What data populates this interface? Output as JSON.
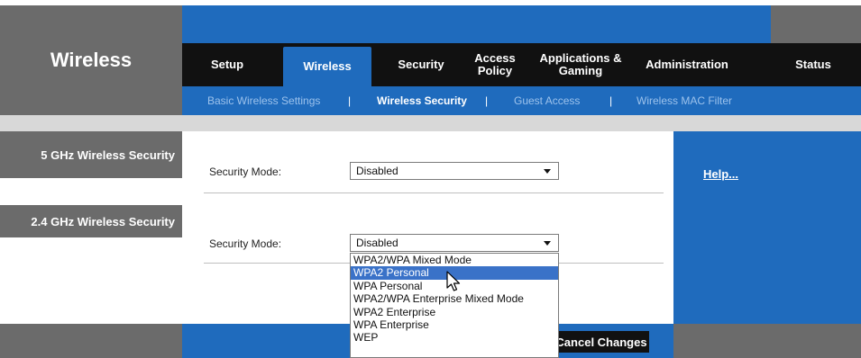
{
  "page_heading": "Wireless",
  "tabs": [
    {
      "label": "Setup"
    },
    {
      "label": "Wireless",
      "active": true
    },
    {
      "label": "Security"
    },
    {
      "label": "Access\nPolicy"
    },
    {
      "label": "Applications &\nGaming"
    },
    {
      "label": "Administration"
    },
    {
      "label": "Status"
    }
  ],
  "subtabs": [
    {
      "label": "Basic Wireless Settings"
    },
    {
      "label": "Wireless Security",
      "active": true
    },
    {
      "label": "Guest Access"
    },
    {
      "label": "Wireless MAC Filter"
    }
  ],
  "subtab_separator": "|",
  "sections": [
    {
      "title": "5 GHz Wireless Security",
      "field_label": "Security Mode:",
      "value": "Disabled"
    },
    {
      "title": "2.4 GHz Wireless Security",
      "field_label": "Security Mode:",
      "value": "Disabled"
    }
  ],
  "dropdown_options": [
    "WPA2/WPA Mixed Mode",
    "WPA2 Personal",
    "WPA Personal",
    "WPA2/WPA Enterprise Mixed Mode",
    "WPA2 Enterprise",
    "WPA Enterprise",
    "WEP"
  ],
  "dropdown_highlighted": "WPA2 Personal",
  "help_link": "Help...",
  "cancel_button": "Cancel Changes",
  "colors": {
    "accent_blue": "#1f6bbd",
    "dark_bar": "#111111",
    "gray": "#6b6b6b",
    "selected_option": "#3a72c8"
  },
  "icons": {
    "select_arrow": "chevron-down-icon",
    "pointer": "mouse-pointer-icon"
  }
}
